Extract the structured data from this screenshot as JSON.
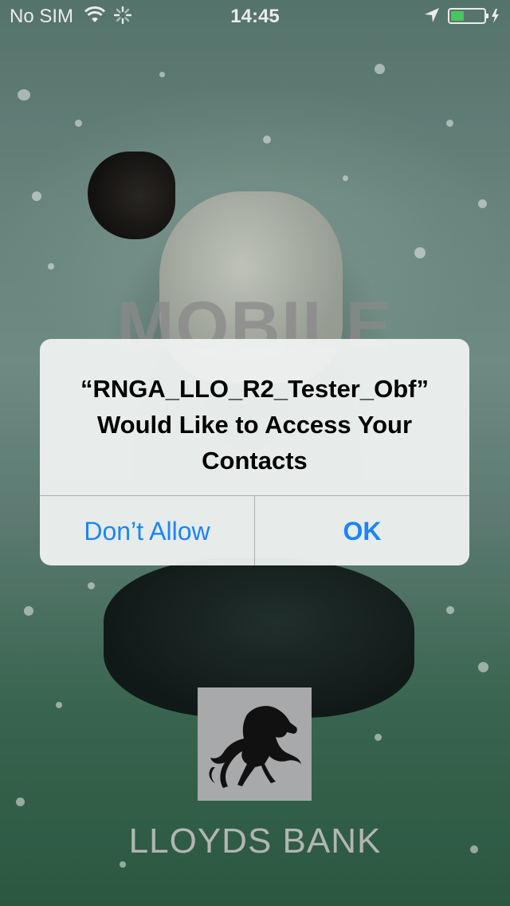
{
  "status_bar": {
    "carrier": "No SIM",
    "time": "14:45",
    "icons": [
      "wifi-icon",
      "activity-spinner-icon",
      "location-arrow-icon",
      "battery-icon"
    ]
  },
  "background": {
    "partial_text": "MOBILE",
    "description_icon": "woman-jumping-in-snow-photo"
  },
  "alert": {
    "title": "“RNGA_LLO_R2_Tester_Obf” Would Like to Access Your Contacts",
    "buttons": {
      "dont_allow": "Don’t Allow",
      "ok": "OK"
    },
    "accent_color": "#1a84ff"
  },
  "brand": {
    "logo_icon": "black-horse-logo-icon",
    "name": "LLOYDS BANK"
  }
}
